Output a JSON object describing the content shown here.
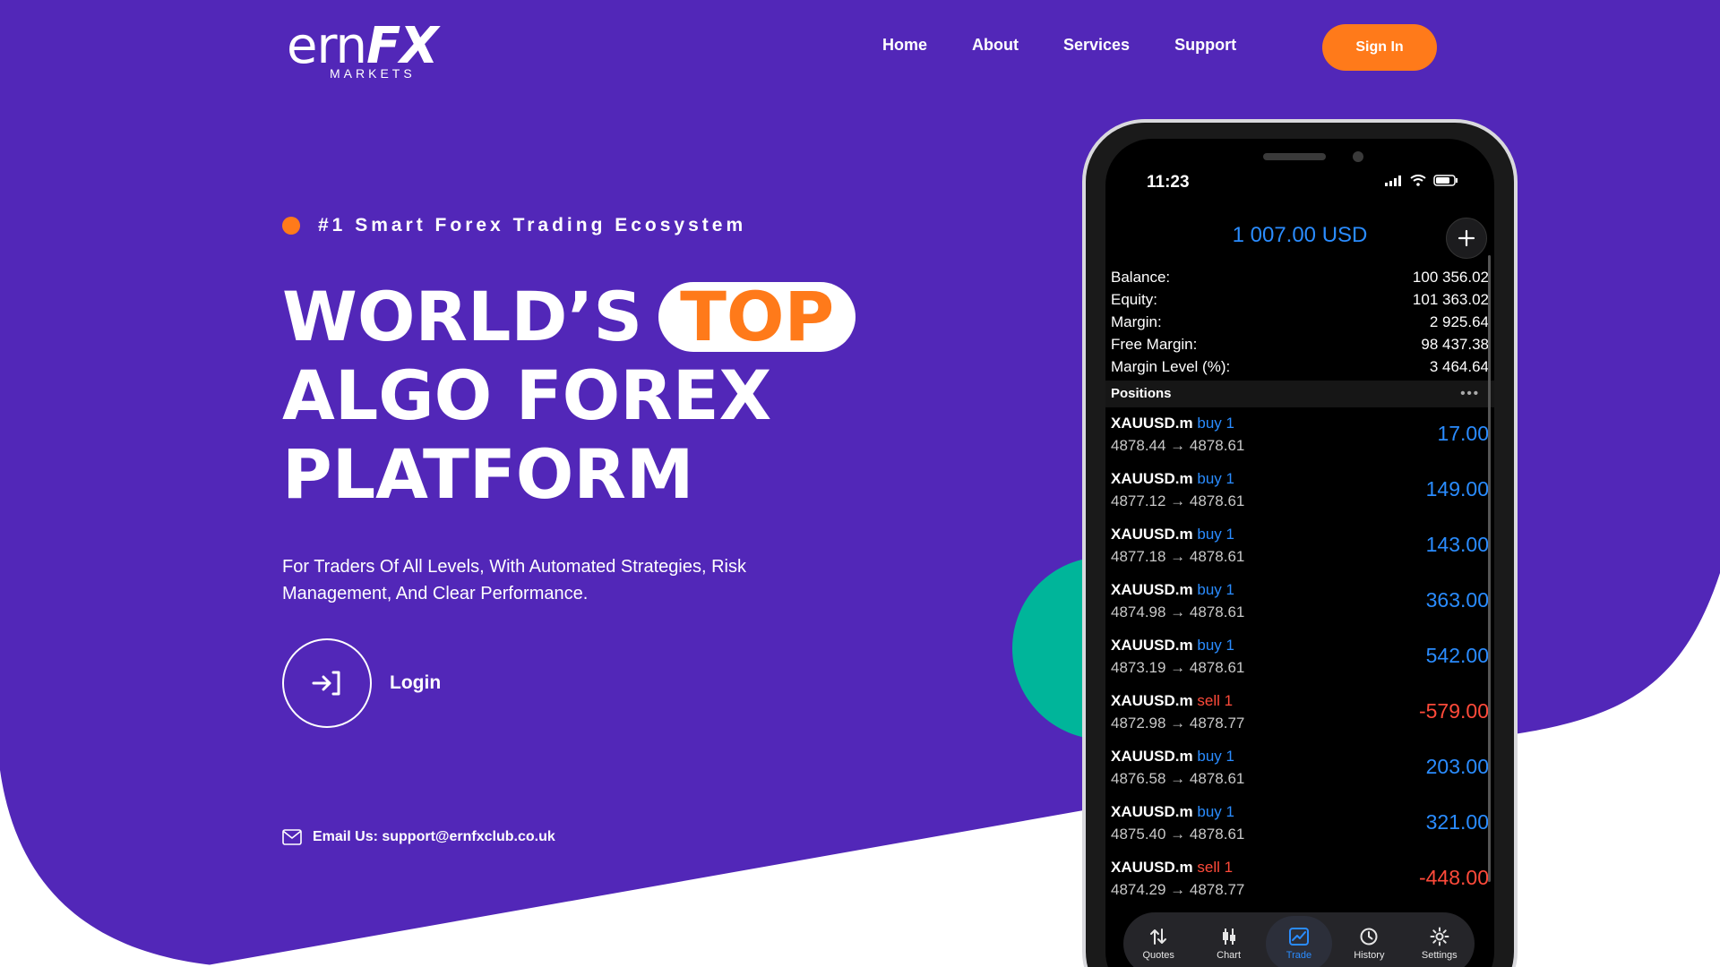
{
  "header": {
    "logo_main": "ern",
    "logo_fx": "FX",
    "logo_sub": "MARKETS",
    "nav": [
      {
        "label": "Home"
      },
      {
        "label": "About"
      },
      {
        "label": "Services"
      },
      {
        "label": "Support"
      }
    ],
    "signin_label": "Sign In"
  },
  "hero": {
    "tagline": "#1 Smart Forex Trading Ecosystem",
    "headline_line1": "WORLD’S",
    "headline_highlight": "TOP",
    "headline_line2": "ALGO FOREX",
    "headline_line3": "PLATFORM",
    "subtitle": "For Traders Of All Levels, With Automated Strategies, Risk Management, And Clear Performance.",
    "login_label": "Login",
    "email_text": "Email Us: support@ernfxclub.co.uk"
  },
  "phone": {
    "time": "11:23",
    "balance_header": "1 007.00 USD",
    "account": [
      {
        "label": "Balance:",
        "value": "100 356.02"
      },
      {
        "label": "Equity:",
        "value": "101 363.02"
      },
      {
        "label": "Margin:",
        "value": "2 925.64"
      },
      {
        "label": "Free Margin:",
        "value": "98 437.38"
      },
      {
        "label": "Margin Level (%):",
        "value": "3 464.64"
      }
    ],
    "positions_title": "Positions",
    "positions": [
      {
        "symbol": "XAUUSD.m",
        "side": "buy 1",
        "type": "buy",
        "prices": "4878.44 → 4878.61",
        "pnl": "17.00",
        "sign": "pos"
      },
      {
        "symbol": "XAUUSD.m",
        "side": "buy 1",
        "type": "buy",
        "prices": "4877.12 → 4878.61",
        "pnl": "149.00",
        "sign": "pos"
      },
      {
        "symbol": "XAUUSD.m",
        "side": "buy 1",
        "type": "buy",
        "prices": "4877.18 → 4878.61",
        "pnl": "143.00",
        "sign": "pos"
      },
      {
        "symbol": "XAUUSD.m",
        "side": "buy 1",
        "type": "buy",
        "prices": "4874.98 → 4878.61",
        "pnl": "363.00",
        "sign": "pos"
      },
      {
        "symbol": "XAUUSD.m",
        "side": "buy 1",
        "type": "buy",
        "prices": "4873.19 → 4878.61",
        "pnl": "542.00",
        "sign": "pos"
      },
      {
        "symbol": "XAUUSD.m",
        "side": "sell 1",
        "type": "sell",
        "prices": "4872.98 → 4878.77",
        "pnl": "-579.00",
        "sign": "neg"
      },
      {
        "symbol": "XAUUSD.m",
        "side": "buy 1",
        "type": "buy",
        "prices": "4876.58 → 4878.61",
        "pnl": "203.00",
        "sign": "pos"
      },
      {
        "symbol": "XAUUSD.m",
        "side": "buy 1",
        "type": "buy",
        "prices": "4875.40 → 4878.61",
        "pnl": "321.00",
        "sign": "pos"
      },
      {
        "symbol": "XAUUSD.m",
        "side": "sell 1",
        "type": "sell",
        "prices": "4874.29 → 4878.77",
        "pnl": "-448.00",
        "sign": "neg"
      }
    ],
    "tabs": [
      {
        "label": "Quotes",
        "icon": "arrows-up-down-icon"
      },
      {
        "label": "Chart",
        "icon": "candlestick-icon"
      },
      {
        "label": "Trade",
        "icon": "trade-chart-icon",
        "active": true
      },
      {
        "label": "History",
        "icon": "history-icon"
      },
      {
        "label": "Settings",
        "icon": "gear-icon"
      }
    ]
  },
  "colors": {
    "hero_purple": "#5227b8",
    "accent_orange": "#ff7a1a",
    "teal": "#00b59a",
    "blue": "#2a8cff",
    "red": "#ff4a3a"
  }
}
